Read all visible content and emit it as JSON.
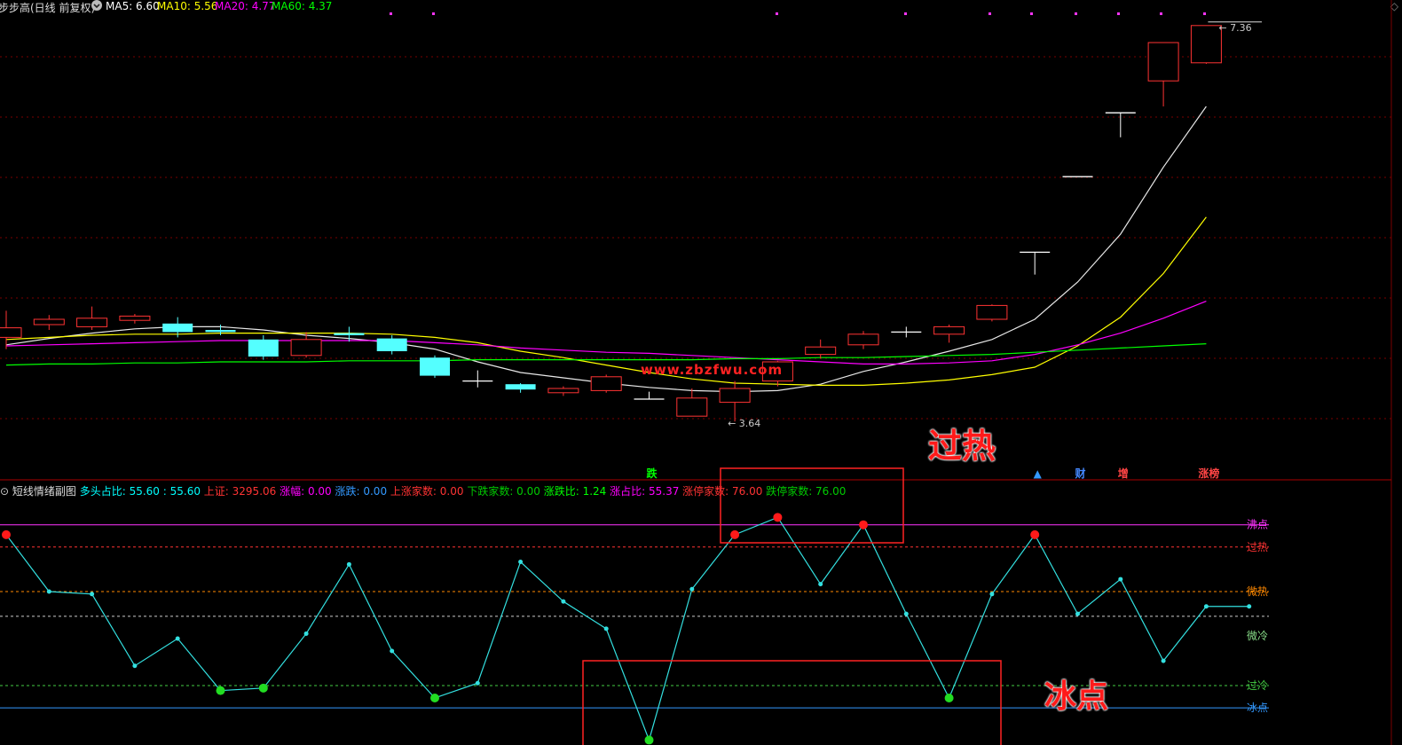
{
  "title_bar": {
    "stock_name": "步步高(日线 前复权)",
    "indicators": [
      {
        "label": "MA5: 6.60",
        "color": "#ffffff"
      },
      {
        "label": "MA10: 5.56",
        "color": "#ffff00"
      },
      {
        "label": "MA20: 4.77",
        "color": "#ff00ff"
      },
      {
        "label": "MA60: 4.37",
        "color": "#00ff00"
      }
    ]
  },
  "sub_header": {
    "name": "短线情绪副图",
    "items": [
      {
        "text": "多头占比: 55.60 : 55.60",
        "color": "#00ffff"
      },
      {
        "text": "上证: 3295.06",
        "color": "#ff3333"
      },
      {
        "text": "涨幅: 0.00",
        "color": "#ff00ff"
      },
      {
        "text": "涨跌: 0.00",
        "color": "#3399ff"
      },
      {
        "text": "上涨家数: 0.00",
        "color": "#ff3333"
      },
      {
        "text": "下跌家数: 0.00",
        "color": "#00cc00"
      },
      {
        "text": "涨跌比: 1.24",
        "color": "#00ff00"
      },
      {
        "text": "涨占比: 55.37",
        "color": "#ff00ff"
      },
      {
        "text": "涨停家数: 76.00",
        "color": "#ff3333"
      },
      {
        "text": "跌停家数: 76.00",
        "color": "#00cc00"
      }
    ]
  },
  "watermark": "www.zbzfwu.com",
  "annotations": {
    "overheat": "过热",
    "freeze": "冰点"
  },
  "markers": [
    {
      "text": "跌",
      "color": "#00ff00",
      "index": 15
    },
    {
      "text": "▲",
      "color": "#3399ff",
      "index": 24
    },
    {
      "text": "财",
      "color": "#4488ff",
      "index": 25
    },
    {
      "text": "增",
      "color": "#ff4444",
      "index": 26
    },
    {
      "text": "涨榜",
      "color": "#ff4444",
      "index": 28
    }
  ],
  "chart_data": [
    {
      "type": "candlestick",
      "price_range": [
        3.1,
        7.6
      ],
      "high_label": "7.36",
      "low_label": "3.64",
      "candles": [
        {
          "o": 4.43,
          "c": 4.52,
          "h": 4.68,
          "l": 4.32
        },
        {
          "o": 4.55,
          "c": 4.6,
          "h": 4.64,
          "l": 4.5
        },
        {
          "o": 4.53,
          "c": 4.61,
          "h": 4.72,
          "l": 4.5
        },
        {
          "o": 4.59,
          "c": 4.63,
          "h": 4.65,
          "l": 4.56
        },
        {
          "o": 4.56,
          "c": 4.48,
          "h": 4.62,
          "l": 4.43
        },
        {
          "o": 4.5,
          "c": 4.48,
          "h": 4.55,
          "l": 4.45
        },
        {
          "o": 4.41,
          "c": 4.25,
          "h": 4.45,
          "l": 4.22
        },
        {
          "o": 4.26,
          "c": 4.41,
          "h": 4.48,
          "l": 4.24
        },
        {
          "o": 4.47,
          "c": 4.45,
          "h": 4.53,
          "l": 4.39
        },
        {
          "o": 4.42,
          "c": 4.3,
          "h": 4.45,
          "l": 4.27
        },
        {
          "o": 4.24,
          "c": 4.07,
          "h": 4.26,
          "l": 4.05
        },
        {
          "o": 4.02,
          "c": 4.02,
          "h": 4.12,
          "l": 3.96
        },
        {
          "o": 3.99,
          "c": 3.94,
          "h": 4.0,
          "l": 3.91
        },
        {
          "o": 3.91,
          "c": 3.95,
          "h": 3.97,
          "l": 3.88
        },
        {
          "o": 3.93,
          "c": 4.06,
          "h": 4.08,
          "l": 3.91
        },
        {
          "o": 3.85,
          "c": 3.85,
          "h": 3.92,
          "l": 3.85
        },
        {
          "o": 3.69,
          "c": 3.86,
          "h": 3.95,
          "l": 3.69
        },
        {
          "o": 3.82,
          "c": 3.95,
          "h": 4.02,
          "l": 3.64
        },
        {
          "o": 4.02,
          "c": 4.2,
          "h": 4.21,
          "l": 3.97
        },
        {
          "o": 4.27,
          "c": 4.34,
          "h": 4.41,
          "l": 4.23
        },
        {
          "o": 4.36,
          "c": 4.46,
          "h": 4.49,
          "l": 4.32
        },
        {
          "o": 4.48,
          "c": 4.48,
          "h": 4.53,
          "l": 4.43
        },
        {
          "o": 4.46,
          "c": 4.53,
          "h": 4.55,
          "l": 4.38
        },
        {
          "o": 4.6,
          "c": 4.73,
          "h": 4.74,
          "l": 4.58
        },
        {
          "o": 5.23,
          "c": 5.23,
          "h": 5.23,
          "l": 5.02
        },
        {
          "o": 5.94,
          "c": 5.94,
          "h": 5.94,
          "l": 5.94
        },
        {
          "o": 6.54,
          "c": 6.54,
          "h": 6.54,
          "l": 6.31
        },
        {
          "o": 6.84,
          "c": 7.2,
          "h": 7.2,
          "l": 6.6
        },
        {
          "o": 7.01,
          "c": 7.36,
          "h": 7.36,
          "l": 7.0
        }
      ],
      "ma_series": [
        {
          "name": "MA5",
          "color": "#e8e8e8",
          "values": [
            4.36,
            4.42,
            4.47,
            4.51,
            4.53,
            4.53,
            4.5,
            4.45,
            4.42,
            4.38,
            4.32,
            4.2,
            4.1,
            4.05,
            4.0,
            3.96,
            3.93,
            3.92,
            3.93,
            3.99,
            4.11,
            4.2,
            4.3,
            4.41,
            4.6,
            4.95,
            5.4,
            6.03,
            6.6
          ]
        },
        {
          "name": "MA10",
          "color": "#ffff00",
          "values": [
            4.41,
            4.43,
            4.45,
            4.46,
            4.46,
            4.47,
            4.47,
            4.47,
            4.47,
            4.46,
            4.43,
            4.38,
            4.3,
            4.24,
            4.17,
            4.1,
            4.04,
            4.0,
            3.99,
            3.98,
            3.98,
            4.0,
            4.03,
            4.08,
            4.15,
            4.35,
            4.62,
            5.03,
            5.56
          ]
        },
        {
          "name": "MA20",
          "color": "#ff00ff",
          "values": [
            4.35,
            4.36,
            4.37,
            4.38,
            4.39,
            4.4,
            4.4,
            4.4,
            4.4,
            4.4,
            4.38,
            4.36,
            4.33,
            4.31,
            4.29,
            4.28,
            4.26,
            4.24,
            4.22,
            4.2,
            4.18,
            4.18,
            4.19,
            4.21,
            4.27,
            4.36,
            4.47,
            4.61,
            4.77
          ]
        },
        {
          "name": "MA60",
          "color": "#00ff00",
          "values": [
            4.17,
            4.18,
            4.18,
            4.19,
            4.19,
            4.2,
            4.2,
            4.2,
            4.21,
            4.21,
            4.21,
            4.22,
            4.22,
            4.22,
            4.22,
            4.22,
            4.22,
            4.23,
            4.23,
            4.24,
            4.24,
            4.25,
            4.26,
            4.27,
            4.29,
            4.31,
            4.33,
            4.35,
            4.37
          ]
        }
      ]
    },
    {
      "type": "line",
      "name": "短线情绪副图",
      "range": [
        0,
        100
      ],
      "values": [
        85,
        62,
        61,
        32,
        43,
        22,
        23,
        45,
        73,
        38,
        19,
        25,
        74,
        58,
        47,
        2,
        63,
        85,
        92,
        65,
        89,
        53,
        19,
        61,
        85,
        53,
        67,
        34,
        56,
        56
      ],
      "levels": [
        {
          "label": "沸点",
          "value": 89,
          "color": "#ff33ff",
          "style": "solid"
        },
        {
          "label": "过热",
          "value": 80,
          "color": "#ff3333",
          "style": "dash"
        },
        {
          "label": "微热",
          "value": 62,
          "color": "#ff8800",
          "style": "dash"
        },
        {
          "label": "",
          "value": 52,
          "color": "#cccccc",
          "style": "dash"
        },
        {
          "label": "微冷",
          "value": 44,
          "color": "#88dd88",
          "style": "none"
        },
        {
          "label": "过冷",
          "value": 24,
          "color": "#44cc44",
          "style": "dash"
        },
        {
          "label": "冰点",
          "value": 15,
          "color": "#3399ff",
          "style": "solid"
        }
      ]
    }
  ]
}
